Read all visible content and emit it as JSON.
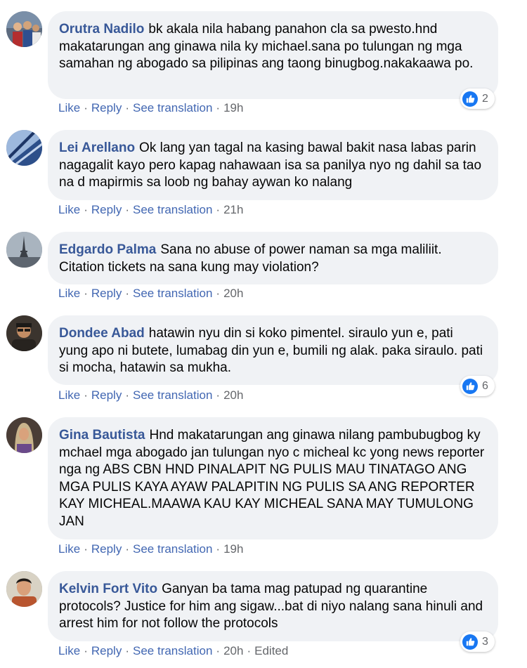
{
  "colors": {
    "author_name": "#385898",
    "action_link": "#4267b2",
    "bubble_bg": "#f0f2f5",
    "like_blue": "#1877f2"
  },
  "actions": {
    "like_label": "Like",
    "reply_label": "Reply",
    "translate_label": "See translation",
    "separator": "·"
  },
  "comments": [
    {
      "author": "Orutra Nadilo",
      "text": "bk akala nila habang panahon cla sa pwesto.hnd makatarungan ang ginawa nila ky michael.sana po tulungan ng mga samahan ng abogado sa pilipinas ang taong binugbog.nakakaawa po.",
      "time": "19h",
      "reaction_icon": "like-icon",
      "reaction_count": "2"
    },
    {
      "author": "Lei Arellano",
      "text": "Ok lang yan tagal na kasing bawal bakit nasa labas parin nagagalit kayo pero kapag nahawaan isa sa panilya nyo ng dahil sa tao na d mapirmis sa loob ng bahay aywan ko nalang",
      "time": "21h"
    },
    {
      "author": "Edgardo Palma",
      "text": "Sana no abuse of power naman sa mga maliliit. Citation tickets na sana kung may violation?",
      "time": "20h"
    },
    {
      "author": "Dondee Abad",
      "text": "hatawin nyu din si koko pimentel. siraulo yun e, pati yung apo ni butete, lumabag din yun e, bumili ng alak. paka siraulo. pati si mocha, hatawin sa mukha.",
      "time": "20h",
      "reaction_icon": "like-icon",
      "reaction_count": "6"
    },
    {
      "author": "Gina Bautista",
      "text": "Hnd makatarungan ang ginawa nilang pambubugbog ky mchael mga abogado jan tulungan nyo c micheal kc yong news reporter nga ng ABS CBN HND PINALAPIT NG PULIS MAU TINATAGO ANG MGA PULIS KAYA AYAW PALAPITIN NG PULIS SA ANG REPORTER KAY MICHEAL.MAAWA KAU KAY MICHEAL SANA MAY TUMULONG JAN",
      "time": "19h"
    },
    {
      "author": "Kelvin Fort Vito",
      "text": "Ganyan ba tama mag patupad ng quarantine protocols? Justice for him ang sigaw...bat di niyo nalang sana hinuli and arrest him for not follow the protocols",
      "time": "20h",
      "edited": "Edited",
      "reaction_icon": "like-icon",
      "reaction_count": "3"
    }
  ]
}
